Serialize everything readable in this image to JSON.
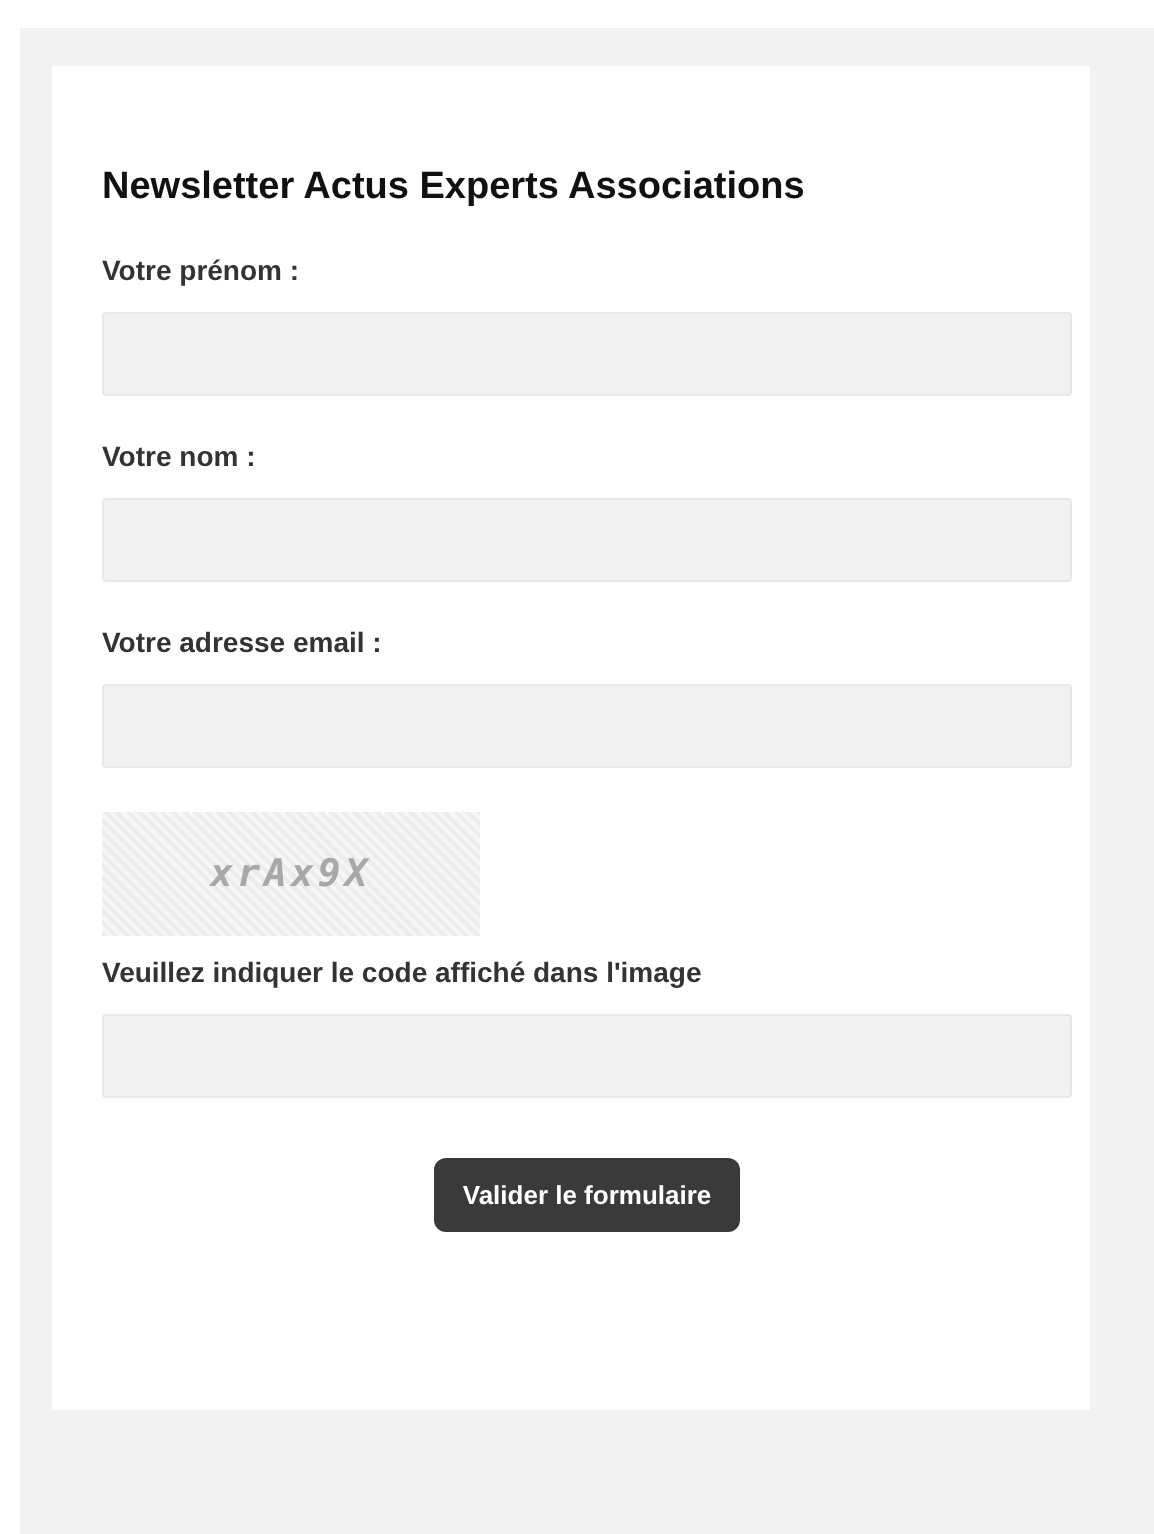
{
  "form": {
    "title": "Newsletter Actus Experts Associations",
    "fields": [
      {
        "label": "Votre prénom :"
      },
      {
        "label": "Votre nom :"
      },
      {
        "label": "Votre adresse email :"
      }
    ],
    "captcha": {
      "code": "xrAx9X",
      "label": "Veuillez indiquer le code affiché dans l'image"
    },
    "submit": "Valider le formulaire"
  }
}
